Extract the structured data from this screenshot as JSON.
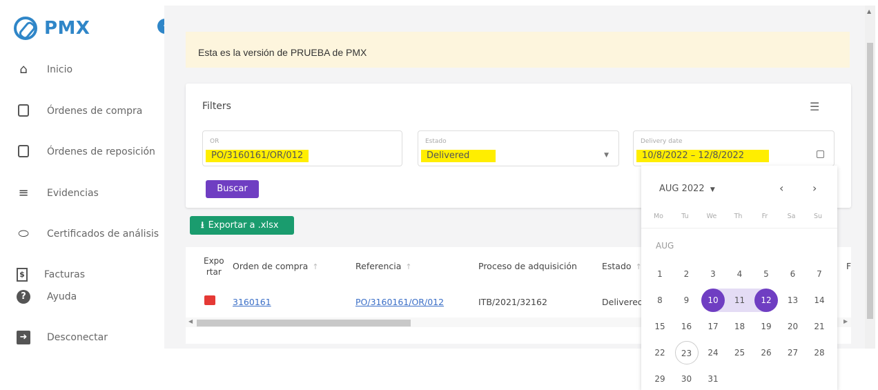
{
  "app": {
    "name": "PMX"
  },
  "sidebar": {
    "items": [
      {
        "label": "Inicio",
        "icon": "home-icon"
      },
      {
        "label": "Órdenes de compra",
        "icon": "document-icon"
      },
      {
        "label": "Órdenes de reposición",
        "icon": "calendar-doc-icon"
      },
      {
        "label": "Evidencias",
        "icon": "list-check-icon"
      },
      {
        "label": "Certificados de análisis",
        "icon": "pill-icon"
      },
      {
        "label": "Facturas",
        "icon": "invoice-icon"
      },
      {
        "label": "Ayuda",
        "icon": "help-icon"
      },
      {
        "label": "Desconectar",
        "icon": "logout-icon"
      }
    ]
  },
  "banner": {
    "text": "Esta es la versión de PRUEBA de PMX"
  },
  "filters": {
    "title": "Filters",
    "or": {
      "label": "OR",
      "value": "PO/3160161/OR/012"
    },
    "estado": {
      "label": "Estado",
      "value": "Delivered"
    },
    "delivery": {
      "label": "Delivery date",
      "value": "10/8/2022 – 12/8/2022"
    },
    "search_button": "Buscar"
  },
  "export_button": "Exportar a .xlsx",
  "table": {
    "headers": {
      "exportar": [
        "Expo",
        "rtar"
      ],
      "orden": "Orden de compra",
      "referencia": "Referencia",
      "proceso": "Proceso de adquisición",
      "estado": "Estado",
      "extra": "F"
    },
    "rows": [
      {
        "orden": "3160161",
        "referencia": "PO/3160161/OR/012",
        "proceso": "ITB/2021/32162",
        "estado": "Delivered"
      }
    ]
  },
  "calendar": {
    "header": "AUG 2022",
    "month_label": "AUG",
    "weekdays": [
      "Mo",
      "Tu",
      "We",
      "Th",
      "Fr",
      "Sa",
      "Su"
    ],
    "weeks": [
      [
        "1",
        "2",
        "3",
        "4",
        "5",
        "6",
        "7"
      ],
      [
        "8",
        "9",
        "10",
        "11",
        "12",
        "13",
        "14"
      ],
      [
        "15",
        "16",
        "17",
        "18",
        "19",
        "20",
        "21"
      ],
      [
        "22",
        "23",
        "24",
        "25",
        "26",
        "27",
        "28"
      ],
      [
        "29",
        "30",
        "31"
      ]
    ],
    "selected_start": "10",
    "selected_end": "12",
    "today": "23",
    "accent": "#6f3ec2"
  }
}
